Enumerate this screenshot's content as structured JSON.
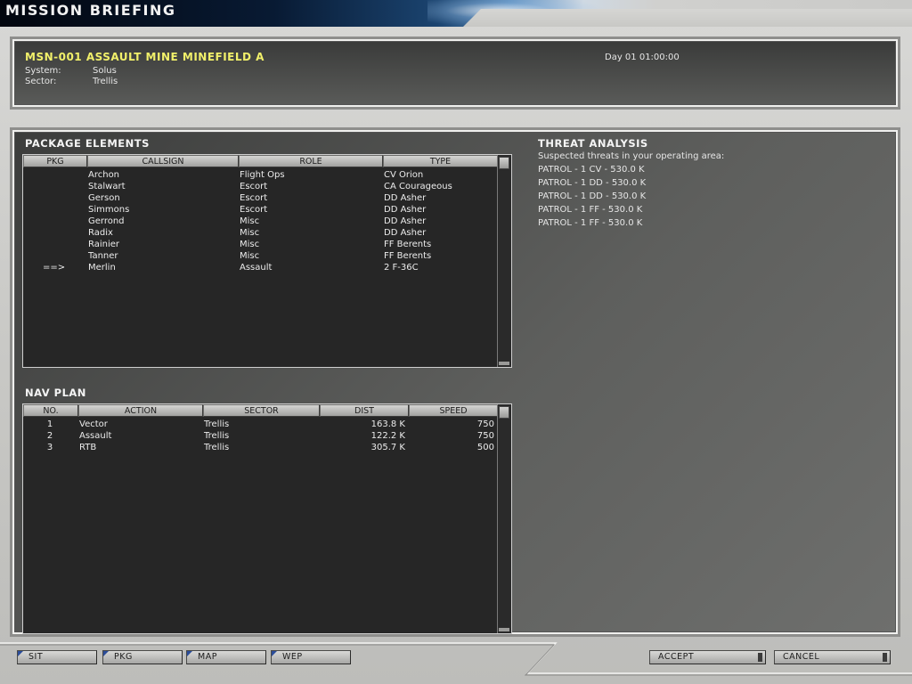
{
  "window": {
    "title": "MISSION BRIEFING"
  },
  "header": {
    "mission": "MSN-001  ASSAULT MINE MINEFIELD A",
    "time": "Day 01 01:00:00",
    "system_label": "System:",
    "system_value": "Solus",
    "sector_label": "Sector:",
    "sector_value": "Trellis"
  },
  "package": {
    "heading": "PACKAGE ELEMENTS",
    "columns": [
      "PKG",
      "CALLSIGN",
      "ROLE",
      "TYPE"
    ],
    "rows": [
      {
        "pkg": "",
        "callsign": "Archon",
        "role": "Flight Ops",
        "type": "CV Orion"
      },
      {
        "pkg": "",
        "callsign": "Stalwart",
        "role": "Escort",
        "type": "CA Courageous"
      },
      {
        "pkg": "",
        "callsign": "Gerson",
        "role": "Escort",
        "type": "DD Asher"
      },
      {
        "pkg": "",
        "callsign": "Simmons",
        "role": "Escort",
        "type": "DD Asher"
      },
      {
        "pkg": "",
        "callsign": "Gerrond",
        "role": "Misc",
        "type": "DD Asher"
      },
      {
        "pkg": "",
        "callsign": "Radix",
        "role": "Misc",
        "type": "DD Asher"
      },
      {
        "pkg": "",
        "callsign": "Rainier",
        "role": "Misc",
        "type": "FF Berents"
      },
      {
        "pkg": "",
        "callsign": "Tanner",
        "role": "Misc",
        "type": "FF Berents"
      },
      {
        "pkg": "==>",
        "callsign": "Merlin",
        "role": "Assault",
        "type": "2 F-36C"
      }
    ]
  },
  "nav": {
    "heading": "NAV PLAN",
    "columns": [
      "NO.",
      "ACTION",
      "SECTOR",
      "DIST",
      "SPEED"
    ],
    "rows": [
      {
        "no": "1",
        "action": "Vector",
        "sector": "Trellis",
        "dist": "163.8 K",
        "speed": "750"
      },
      {
        "no": "2",
        "action": "Assault",
        "sector": "Trellis",
        "dist": "122.2 K",
        "speed": "750"
      },
      {
        "no": "3",
        "action": "RTB",
        "sector": "Trellis",
        "dist": "305.7 K",
        "speed": "500"
      }
    ]
  },
  "threat": {
    "heading": "THREAT ANALYSIS",
    "intro": "Suspected threats in your operating area:",
    "items": [
      "PATROL - 1 CV - 530.0 K",
      "PATROL - 1 DD - 530.0 K",
      "PATROL - 1 DD - 530.0 K",
      "PATROL - 1 FF - 530.0 K",
      "PATROL - 1 FF - 530.0 K"
    ]
  },
  "tabs": {
    "sit": "SIT",
    "pkg": "PKG",
    "map": "MAP",
    "wep": "WEP"
  },
  "actions": {
    "accept": "ACCEPT",
    "cancel": "CANCEL"
  },
  "colors": {
    "accent_yellow": "#f1f06a",
    "tab_marker": "#2b4d9a"
  }
}
